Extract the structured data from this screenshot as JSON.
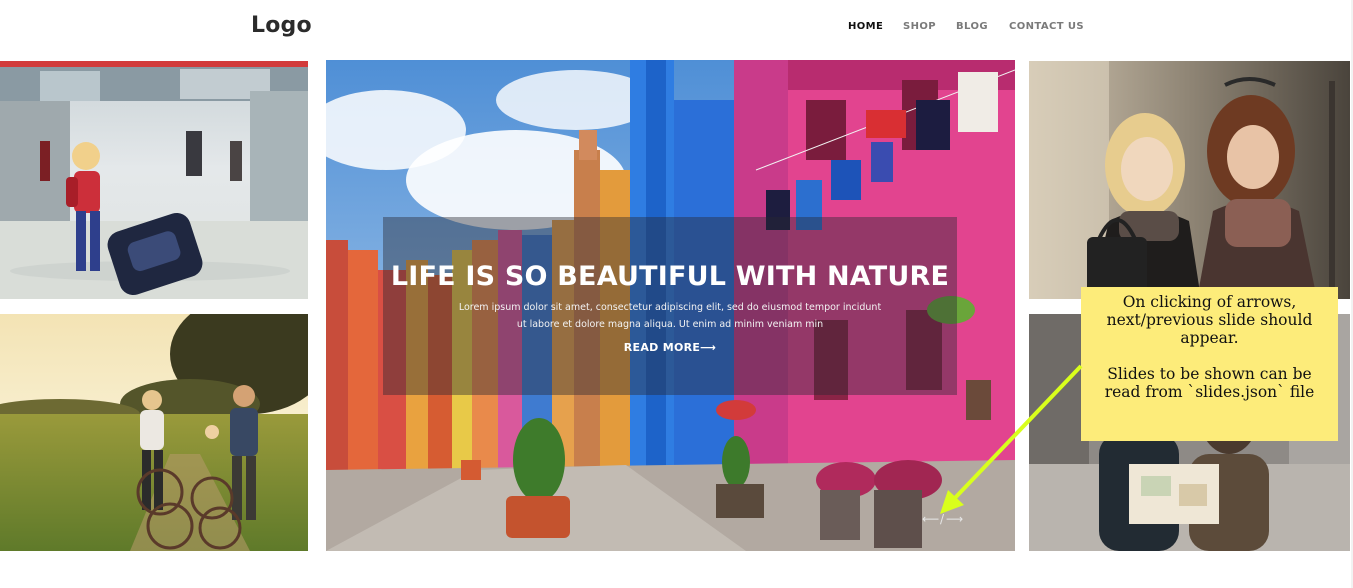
{
  "header": {
    "logo": "Logo",
    "nav": [
      {
        "label": "HOME",
        "active": true
      },
      {
        "label": "SHOP",
        "active": false
      },
      {
        "label": "BLOG",
        "active": false
      },
      {
        "label": "CONTACT US",
        "active": false
      }
    ]
  },
  "hero": {
    "title": "LIFE IS SO BEAUTIFUL WITH NATURE",
    "text": "Lorem ipsum dolor sit amet, consectetur adipiscing elit, sed do eiusmod tempor incidunt ut labore et dolore magna aliqua. Ut enim ad minim veniam min",
    "read_more": "READ MORE⟶",
    "prev_icon": "arrow-left-icon",
    "next_icon": "arrow-right-icon",
    "arrow_prev": "⟵",
    "arrow_sep": "/",
    "arrow_next": "⟶"
  },
  "tiles": {
    "top_left": "airport-child-photo",
    "bottom_left": "couple-bicycles-field-photo",
    "top_right": "two-women-photo",
    "bottom_right": "couple-map-photo"
  },
  "annotation": {
    "text": "On clicking of arrows, next/previous slide should appear.\n\nSlides to be shown can be read from `slides.json` file",
    "color": "#fdec7a",
    "arrow_color": "#d9ff1c"
  },
  "colors": {
    "nav_active": "#111111",
    "nav_inactive": "#7a7a7a",
    "logo": "#2b2b2b"
  }
}
